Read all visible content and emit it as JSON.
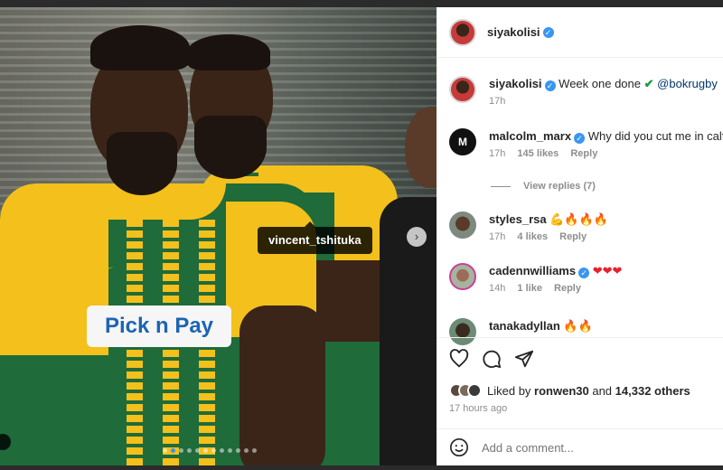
{
  "photo": {
    "user_tag": "vincent_tshituka",
    "sponsor_text": "Pick n Pay",
    "carousel_dots": 12,
    "active_dot": 1
  },
  "header": {
    "username": "siyakolisi"
  },
  "comments": [
    {
      "user": "siyakolisi",
      "text": "Week one done ",
      "check": "✔",
      "mention": "@bokrugby",
      "time": "17h",
      "avatar": "av-red",
      "verified": true
    },
    {
      "user": "malcolm_marx",
      "text": "Why did you cut me in calf 🤔",
      "time": "17h",
      "likes": "145 likes",
      "reply": "Reply",
      "avatar": "av-malcolm",
      "verified": true
    },
    {
      "user": "styles_rsa",
      "text": "💪🔥🔥🔥",
      "time": "17h",
      "likes": "4 likes",
      "reply": "Reply",
      "avatar": "av-styles"
    },
    {
      "user": "cadennwilliams",
      "text": "❤❤❤",
      "time": "14h",
      "likes": "1 like",
      "reply": "Reply",
      "avatar": "av-caden",
      "verified": true
    },
    {
      "user": "tanakadyllan",
      "text": "🔥🔥",
      "avatar": "av-tanaka"
    }
  ],
  "view_replies": "View replies (7)",
  "likes": {
    "prefix": "Liked by ",
    "user": "ronwen30",
    "suffix": " and ",
    "others": "14,332 others"
  },
  "posted": "17 hours ago",
  "add_comment": {
    "placeholder": "Add a comment..."
  },
  "icons": [
    "heart-icon",
    "comment-icon",
    "share-icon",
    "emoji-icon",
    "verified-badge-icon",
    "chevron-right-icon"
  ],
  "colors": {
    "accent": "#3897f0",
    "jersey_green": "#1f6b3a",
    "jersey_gold": "#f3c01c",
    "heart": "#e8202d"
  }
}
